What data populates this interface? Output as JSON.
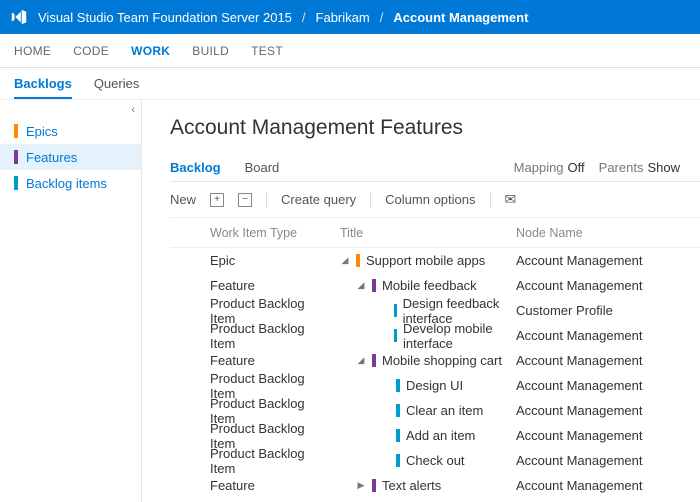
{
  "breadcrumb": {
    "product": "Visual Studio Team Foundation Server 2015",
    "project": "Fabrikam",
    "area": "Account Management"
  },
  "hubs": [
    "HOME",
    "CODE",
    "WORK",
    "BUILD",
    "TEST"
  ],
  "hub_active": "WORK",
  "subhubs": [
    "Backlogs",
    "Queries"
  ],
  "subhub_active": "Backlogs",
  "sidebar": {
    "items": [
      {
        "label": "Epics",
        "color": "orange",
        "selected": false
      },
      {
        "label": "Features",
        "color": "purple",
        "selected": true
      },
      {
        "label": "Backlog items",
        "color": "teal",
        "selected": false
      }
    ]
  },
  "page_title": "Account Management Features",
  "views": {
    "backlog": "Backlog",
    "board": "Board"
  },
  "view_active": "Backlog",
  "options": {
    "mapping_label": "Mapping",
    "mapping_value": "Off",
    "parents_label": "Parents",
    "parents_value": "Show"
  },
  "toolbar": {
    "new": "New",
    "create_query": "Create query",
    "column_options": "Column options"
  },
  "columns": {
    "type": "Work Item Type",
    "title": "Title",
    "node": "Node Name"
  },
  "rows": [
    {
      "type": "Epic",
      "indent": 0,
      "exp": "down",
      "color": "orange",
      "title": "Support mobile apps",
      "node": "Account Management"
    },
    {
      "type": "Feature",
      "indent": 1,
      "exp": "down",
      "color": "purple",
      "title": "Mobile feedback",
      "node": "Account Management"
    },
    {
      "type": "Product Backlog Item",
      "indent": 2,
      "exp": "",
      "color": "teal",
      "title": "Design feedback interface",
      "node": "Customer Profile"
    },
    {
      "type": "Product Backlog Item",
      "indent": 2,
      "exp": "",
      "color": "teal",
      "title": "Develop mobile interface",
      "node": "Account Management"
    },
    {
      "type": "Feature",
      "indent": 1,
      "exp": "down",
      "color": "purple",
      "title": "Mobile shopping cart",
      "node": "Account Management"
    },
    {
      "type": "Product Backlog Item",
      "indent": 2,
      "exp": "",
      "color": "teal",
      "title": "Design UI",
      "node": "Account Management"
    },
    {
      "type": "Product Backlog Item",
      "indent": 2,
      "exp": "",
      "color": "teal",
      "title": "Clear an item",
      "node": "Account Management"
    },
    {
      "type": "Product Backlog Item",
      "indent": 2,
      "exp": "",
      "color": "teal",
      "title": "Add an item",
      "node": "Account Management"
    },
    {
      "type": "Product Backlog Item",
      "indent": 2,
      "exp": "",
      "color": "teal",
      "title": "Check out",
      "node": "Account Management"
    },
    {
      "type": "Feature",
      "indent": 1,
      "exp": "right",
      "color": "purple",
      "title": "Text alerts",
      "node": "Account Management"
    }
  ]
}
